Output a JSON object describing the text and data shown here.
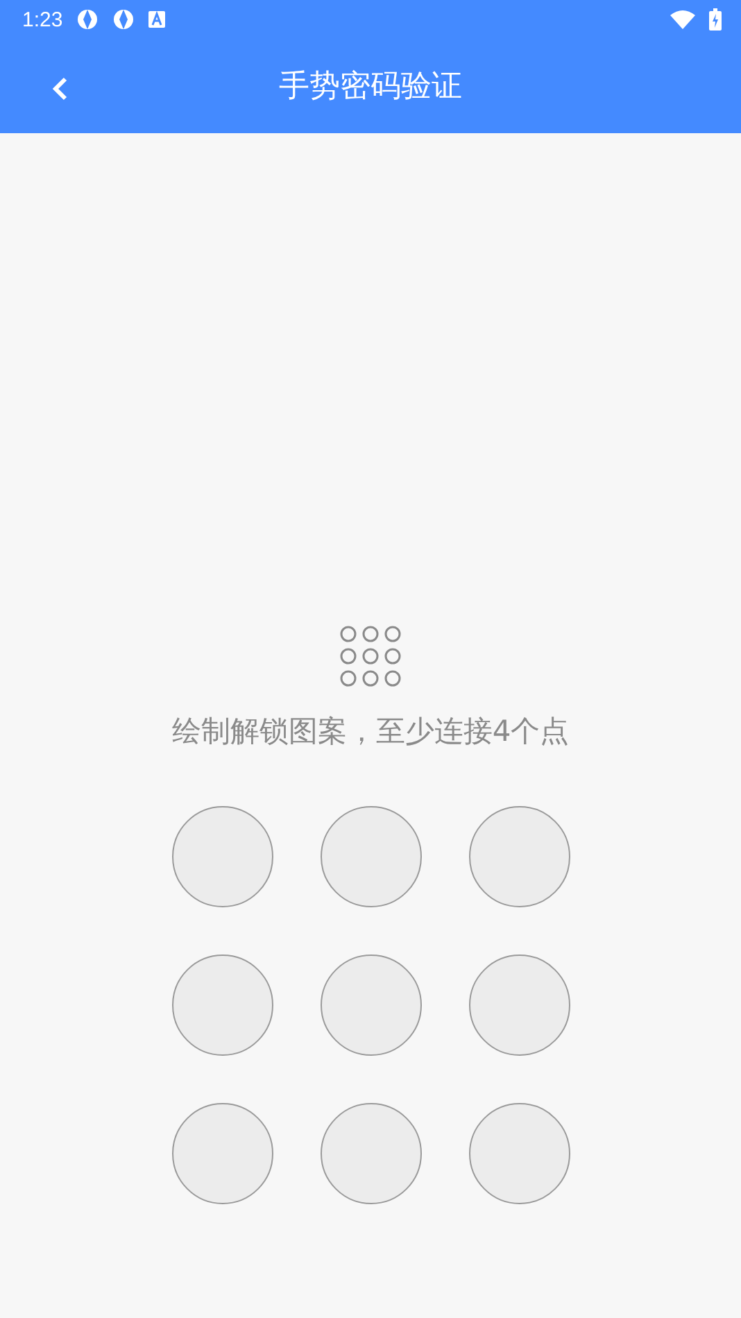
{
  "status_bar": {
    "time": "1:23"
  },
  "app_bar": {
    "title": "手势密码验证"
  },
  "hint": {
    "text": "绘制解锁图案，至少连接4个点"
  },
  "pattern_grid": {
    "dots": [
      {
        "selected": false
      },
      {
        "selected": false
      },
      {
        "selected": false
      },
      {
        "selected": false
      },
      {
        "selected": false
      },
      {
        "selected": false
      },
      {
        "selected": false
      },
      {
        "selected": false
      },
      {
        "selected": false
      }
    ]
  }
}
